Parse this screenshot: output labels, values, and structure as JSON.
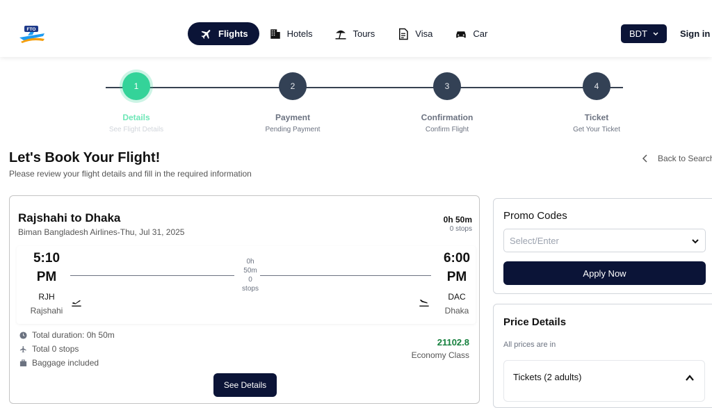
{
  "header": {
    "logo_text": "FTO",
    "nav": [
      {
        "label": "Flights",
        "icon": "plane-icon",
        "active": true
      },
      {
        "label": "Hotels",
        "icon": "building-icon",
        "active": false
      },
      {
        "label": "Tours",
        "icon": "beach-umbrella-icon",
        "active": false
      },
      {
        "label": "Visa",
        "icon": "document-icon",
        "active": false
      },
      {
        "label": "Car",
        "icon": "car-icon",
        "active": false
      }
    ],
    "currency": "BDT",
    "signin": "Sign in"
  },
  "stepper": [
    {
      "number": "1",
      "title": "Details",
      "subtitle": "See Flight Details",
      "active": true
    },
    {
      "number": "2",
      "title": "Payment",
      "subtitle": "Pending Payment",
      "active": false
    },
    {
      "number": "3",
      "title": "Confirmation",
      "subtitle": "Confirm Flight",
      "active": false
    },
    {
      "number": "4",
      "title": "Ticket",
      "subtitle": "Get Your Ticket",
      "active": false
    }
  ],
  "page": {
    "title": "Let's Book Your Flight!",
    "subtitle": "Please review your flight details and fill in the required information",
    "back_link": "Back to Search"
  },
  "flight": {
    "route": "Rajshahi to Dhaka",
    "airline_date": "Biman Bangladesh Airlines-Thu, Jul 31, 2025",
    "duration": "0h 50m",
    "stops": "0 stops",
    "depart_time_1": "5:10",
    "depart_time_2": "PM",
    "depart_code": "RJH",
    "depart_city": "Rajshahi",
    "arrive_time_1": "6:00",
    "arrive_time_2": "PM",
    "arrive_code": "DAC",
    "arrive_city": "Dhaka",
    "mid_h": "0h",
    "mid_m": "50m",
    "mid_stops_n": "0",
    "mid_stops_label": "stops",
    "total_duration": "Total duration: 0h 50m",
    "total_stops": "Total 0 stops",
    "baggage": "Baggage included",
    "price": "21102.8",
    "class": "Economy Class",
    "see_details": "See Details"
  },
  "promo": {
    "title": "Promo Codes",
    "placeholder": "Select/Enter",
    "apply": "Apply Now"
  },
  "price_details": {
    "title": "Price Details",
    "note": "All prices are in",
    "tickets": "Tickets (2 adults)"
  },
  "colors": {
    "navy": "#0b1437",
    "active_step": "#34d399",
    "price_green": "#15803d"
  }
}
